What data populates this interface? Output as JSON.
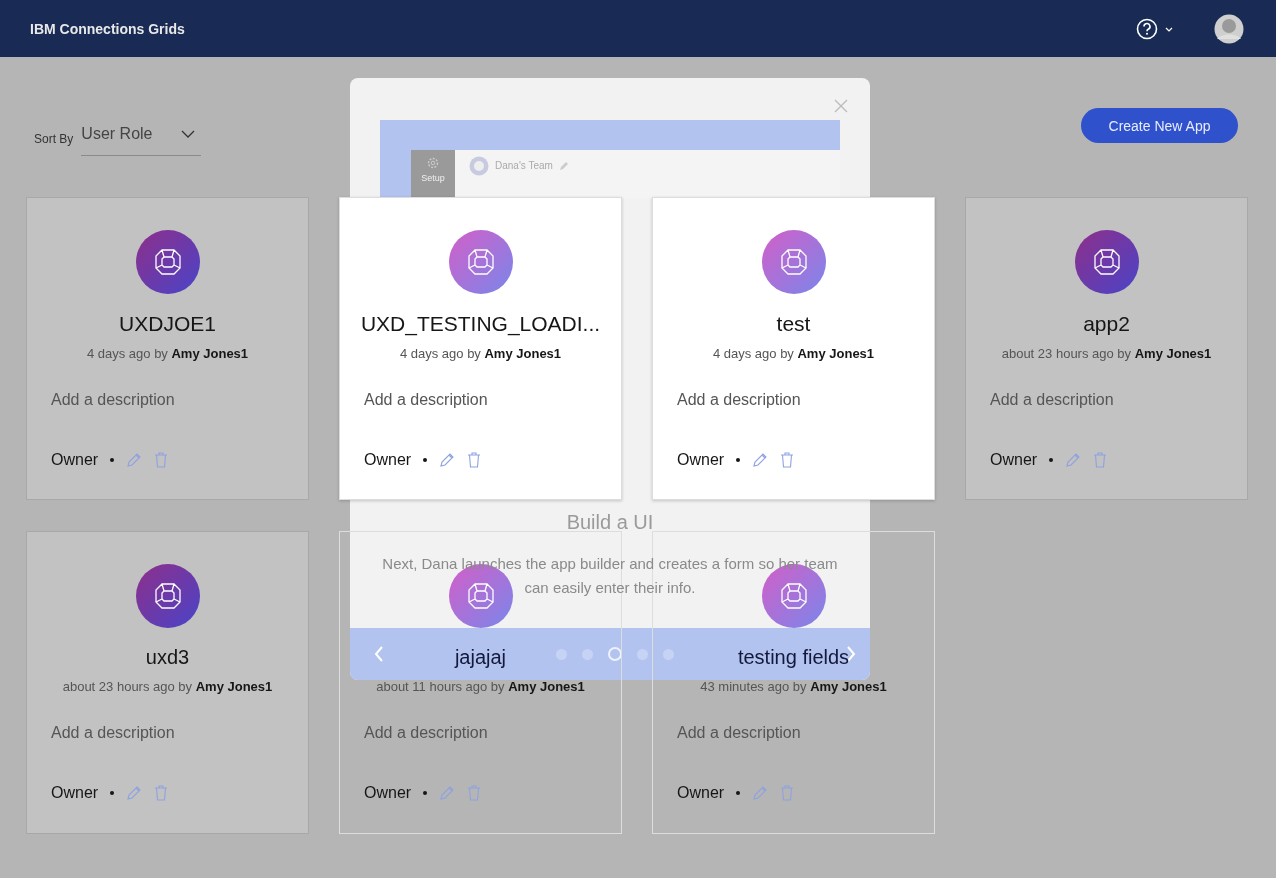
{
  "header": {
    "title": "IBM Connections Grids",
    "help_menu": {
      "expanded": false
    }
  },
  "toolbar": {
    "sort_label": "Sort By",
    "sort_value": "User Role",
    "create_button": "Create New App"
  },
  "apps": [
    {
      "name": "UXDJOE1",
      "modified": "4 days ago by",
      "author": "Amy Jones1",
      "description_placeholder": "Add a description",
      "role": "Owner",
      "highlighted": false
    },
    {
      "name": "UXD_TESTING_LOADI...",
      "modified": "4 days ago by",
      "author": "Amy Jones1",
      "description_placeholder": "Add a description",
      "role": "Owner",
      "highlighted": true
    },
    {
      "name": "test",
      "modified": "4 days ago by",
      "author": "Amy Jones1",
      "description_placeholder": "Add a description",
      "role": "Owner",
      "highlighted": true
    },
    {
      "name": "app2",
      "modified": "about 23 hours ago by",
      "author": "Amy Jones1",
      "description_placeholder": "Add a description",
      "role": "Owner",
      "highlighted": false
    },
    {
      "name": "uxd3",
      "modified": "about 23 hours ago by",
      "author": "Amy Jones1",
      "description_placeholder": "Add a description",
      "role": "Owner",
      "highlighted": false
    },
    {
      "name": "jajajaj",
      "modified": "about 11 hours ago by",
      "author": "Amy Jones1",
      "description_placeholder": "Add a description",
      "role": "Owner",
      "highlighted": true
    },
    {
      "name": "testing fields",
      "modified": "43 minutes ago by",
      "author": "Amy Jones1",
      "description_placeholder": "Add a description",
      "role": "Owner",
      "highlighted": true
    }
  ],
  "tour_dialog": {
    "preview": {
      "team_name": "Dana's Team",
      "sidebar_label": "Setup"
    },
    "title": "Build a UI",
    "text": "Next, Dana launches the app builder and creates a form so her team can easily enter their info.",
    "dots": [
      {
        "selected": false
      },
      {
        "selected": false
      },
      {
        "selected": true
      },
      {
        "selected": false
      },
      {
        "selected": false
      }
    ]
  }
}
